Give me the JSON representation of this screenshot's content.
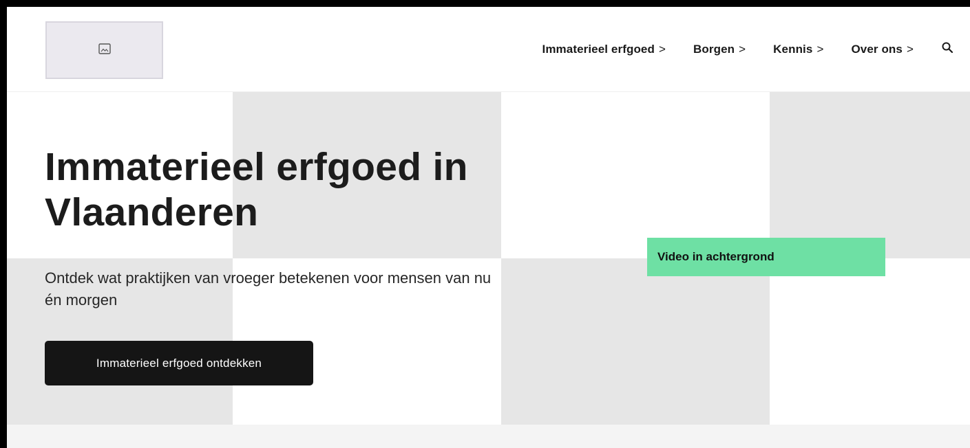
{
  "header": {
    "logo_icon": "image-placeholder-icon",
    "nav": [
      {
        "label": "Immaterieel erfgoed",
        "chevron": ">"
      },
      {
        "label": "Borgen",
        "chevron": ">"
      },
      {
        "label": "Kennis",
        "chevron": ">"
      },
      {
        "label": "Over ons",
        "chevron": ">"
      }
    ],
    "search_icon": "search-icon"
  },
  "hero": {
    "title": "Immaterieel erfgoed in Vlaanderen",
    "subtitle": "Ontdek wat praktijken van vroeger betekenen voor mensen van nu én morgen",
    "cta_label": "Immaterieel erfgoed ontdekken",
    "video_label": "Video in achtergrond"
  },
  "colors": {
    "accent_green": "#6ee0a4",
    "cta_background": "#151515",
    "tile_grey": "#e6e6e6"
  }
}
